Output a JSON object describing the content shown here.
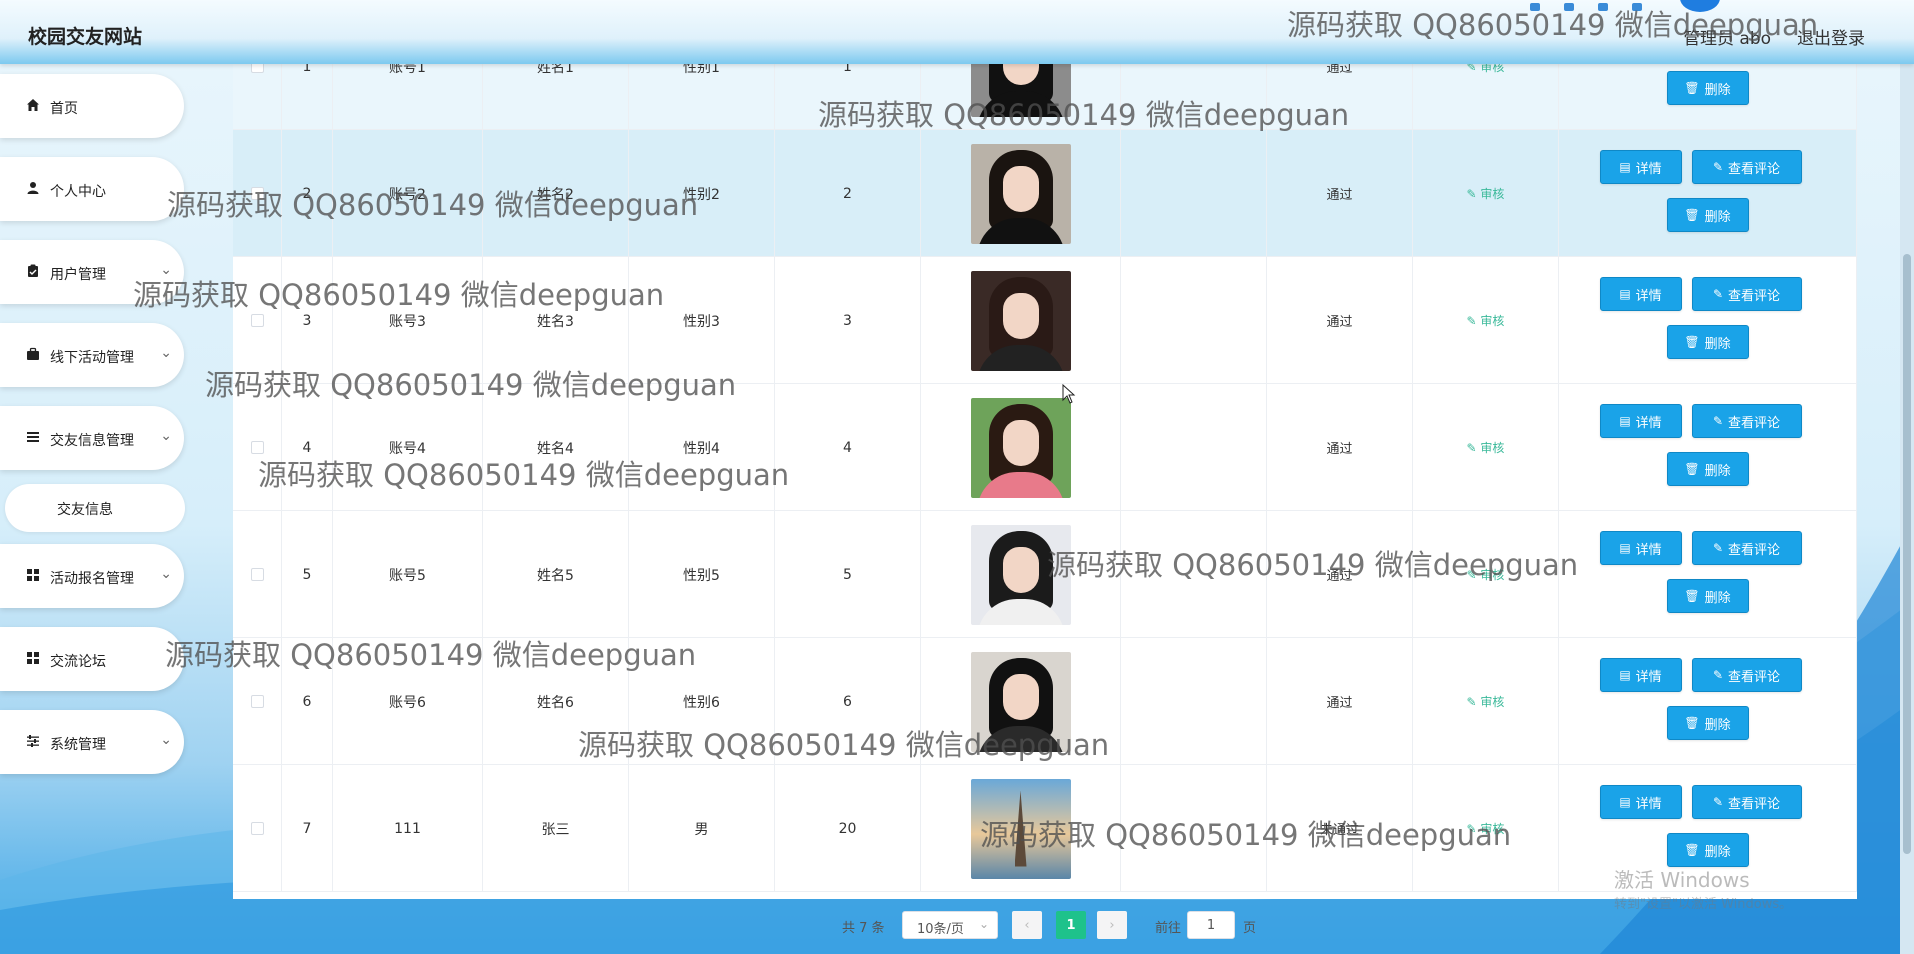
{
  "header": {
    "site_title": "校园交友网站",
    "admin_user": "管理员 abo",
    "logout_label": "退出登录"
  },
  "sidebar": {
    "items": [
      {
        "label": "首页",
        "icon": "home-icon"
      },
      {
        "label": "个人中心",
        "icon": "user-icon"
      },
      {
        "label": "用户管理",
        "icon": "clipboard-icon"
      },
      {
        "label": "线下活动管理",
        "icon": "briefcase-icon"
      },
      {
        "label": "交友信息管理",
        "icon": "list-icon"
      },
      {
        "label": "活动报名管理",
        "icon": "grid-icon"
      },
      {
        "label": "交流论坛",
        "icon": "grid-icon"
      },
      {
        "label": "系统管理",
        "icon": "sliders-icon"
      }
    ],
    "submenu_active": "交友信息"
  },
  "table": {
    "rows": [
      {
        "index": "1",
        "account": "账号1",
        "name": "姓名1",
        "gender": "性别1",
        "age": "1",
        "status": "通过",
        "audit": "审核"
      },
      {
        "index": "2",
        "account": "账号2",
        "name": "姓名2",
        "gender": "性别2",
        "age": "2",
        "status": "通过",
        "audit": "审核"
      },
      {
        "index": "3",
        "account": "账号3",
        "name": "姓名3",
        "gender": "性别3",
        "age": "3",
        "status": "通过",
        "audit": "审核"
      },
      {
        "index": "4",
        "account": "账号4",
        "name": "姓名4",
        "gender": "性别4",
        "age": "4",
        "status": "通过",
        "audit": "审核"
      },
      {
        "index": "5",
        "account": "账号5",
        "name": "姓名5",
        "gender": "性别5",
        "age": "5",
        "status": "通过",
        "audit": "审核"
      },
      {
        "index": "6",
        "account": "账号6",
        "name": "姓名6",
        "gender": "性别6",
        "age": "6",
        "status": "通过",
        "audit": "审核"
      },
      {
        "index": "7",
        "account": "111",
        "name": "张三",
        "gender": "男",
        "age": "20",
        "status": "未通过",
        "audit": "审核"
      }
    ],
    "buttons": {
      "detail": "详情",
      "comments": "查看评论",
      "delete": "删除"
    }
  },
  "pagination": {
    "total_text": "共 7 条",
    "page_size": "10条/页",
    "current_page": "1",
    "goto_label": "前往",
    "goto_value": "1",
    "page_suffix": "页"
  },
  "watermark": {
    "text": "源码获取 QQ86050149 微信deepguan"
  },
  "os_overlay": {
    "activate_title": "激活 Windows",
    "activate_sub": "转到\"设置\"以激活 Windows。"
  },
  "colors": {
    "accent_button": "#1aa3e8",
    "page_active": "#1ec28b",
    "audit_link": "#3bb99a"
  }
}
